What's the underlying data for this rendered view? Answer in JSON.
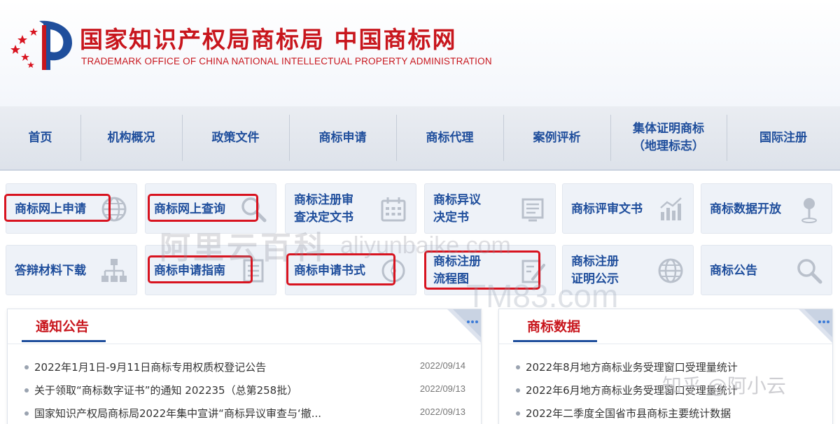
{
  "header": {
    "title_cn": "国家知识产权局商标局 中国商标网",
    "title_en": "TRADEMARK OFFICE OF CHINA NATIONAL INTELLECTUAL PROPERTY ADMINISTRATION"
  },
  "nav": [
    {
      "label": "首页",
      "w": 115
    },
    {
      "label": "机构概况",
      "w": 145
    },
    {
      "label": "政策文件",
      "w": 153
    },
    {
      "label": "商标申请",
      "w": 153
    },
    {
      "label": "商标代理",
      "w": 153
    },
    {
      "label": "案例评析",
      "w": 153
    },
    {
      "label": "集体证明商标\n（地理标志）",
      "w": 166
    },
    {
      "label": "国际注册",
      "w": 162
    }
  ],
  "tiles_row1": [
    {
      "label": "商标网上申请",
      "icon": "globe-icon"
    },
    {
      "label": "商标网上查询",
      "icon": "search-icon"
    },
    {
      "label": "商标注册审\n查决定文书",
      "icon": "calendar-icon"
    },
    {
      "label": "商标异议\n决定书",
      "icon": "document-icon"
    },
    {
      "label": "商标评审文书",
      "icon": "chart-icon"
    },
    {
      "label": "商标数据开放",
      "icon": "pin-icon"
    }
  ],
  "tiles_row2": [
    {
      "label": "答辩材料下载",
      "icon": "hierarchy-icon"
    },
    {
      "label": "商标申请指南",
      "icon": "list-icon"
    },
    {
      "label": "商标申请书式",
      "icon": "compass-icon"
    },
    {
      "label": "商标注册\n流程图",
      "icon": "edit-icon"
    },
    {
      "label": "商标注册\n证明公示",
      "icon": "globe-icon"
    },
    {
      "label": "商标公告",
      "icon": "search-icon"
    }
  ],
  "notice": {
    "title": "通知公告",
    "items": [
      {
        "text": "2022年1月1日-9月11日商标专用权质权登记公告",
        "date": "2022/09/14"
      },
      {
        "text": "关于领取“商标数字证书”的通知 202235（总第258批）",
        "date": "2022/09/13"
      },
      {
        "text": "国家知识产权局商标局2022年集中宣讲“商标异议审查与‘撤...",
        "date": "2022/09/13"
      }
    ]
  },
  "data_panel": {
    "title": "商标数据",
    "items": [
      {
        "text": "2022年8月地方商标业务受理窗口受理量统计"
      },
      {
        "text": "2022年6月地方商标业务受理窗口受理量统计"
      },
      {
        "text": "2022年二季度全国省市县商标主要统计数据"
      }
    ]
  },
  "watermarks": {
    "aliyun": "阿里云百科",
    "aliyun_url": "aliyunbaike.com",
    "tm83": "TM83.com",
    "zhihu": "知乎 @阿小云"
  },
  "colors": {
    "brand_red": "#c8161d",
    "nav_blue": "#1f4e9c",
    "highlight": "#d8131f"
  }
}
